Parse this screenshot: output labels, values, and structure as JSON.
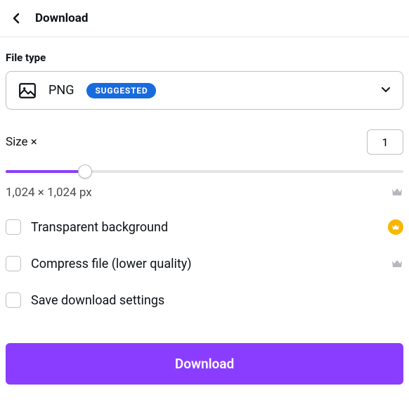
{
  "header": {
    "title": "Download"
  },
  "fileType": {
    "label": "File type",
    "value": "PNG",
    "badge": "SUGGESTED"
  },
  "size": {
    "label": "Size ×",
    "value": "1",
    "dimensions": "1,024 × 1,024 px"
  },
  "options": {
    "transparent": "Transparent background",
    "compress": "Compress file (lower quality)",
    "save": "Save download settings"
  },
  "downloadButton": "Download"
}
